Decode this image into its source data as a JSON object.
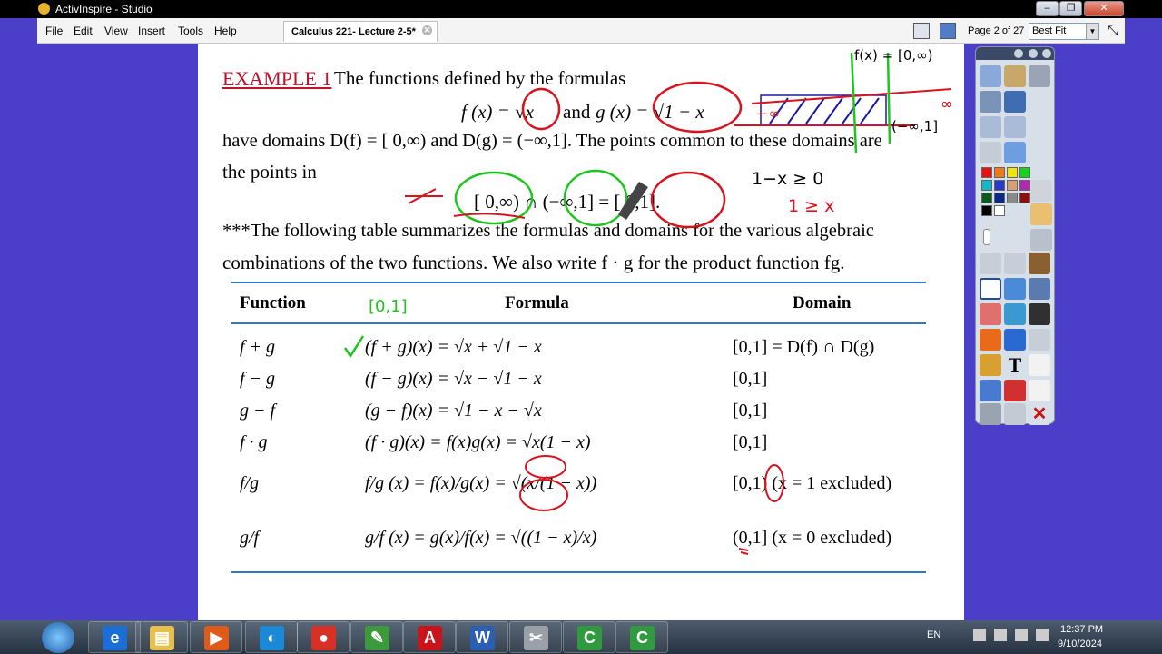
{
  "window": {
    "title": "ActivInspire - Studio",
    "buttons": [
      "–",
      "❐",
      "✕"
    ]
  },
  "menu": {
    "items": [
      "File",
      "Edit",
      "View",
      "Insert",
      "Tools",
      "Help"
    ],
    "doc_tab": "Calculus 221- Lecture 2-5*",
    "doc_tab_close": "✕",
    "page_indicator": "Page 2 of 27",
    "zoom": "Best Fit",
    "zoom_arrow": "▼",
    "expand_glyph": "⤡"
  },
  "slide": {
    "example_label": "EXAMPLE 1",
    "line1": "The functions defined by the formulas",
    "formula_f": "f (x) = √x",
    "formula_and": "and",
    "formula_g": "g (x) = √1 − x",
    "line3": "have domains D(f) = [ 0,∞) and D(g) = (−∞,1]. The points common to these domains are",
    "line4": "the points in",
    "intersection": "[ 0,∞) ∩ (−∞,1] = [ 0,1].",
    "line5": "***The following table summarizes the formulas and domains for the various algebraic",
    "line6": "combinations of the two functions. We also write f · g for the product function fg.",
    "table": {
      "headers": [
        "Function",
        "Formula",
        "Domain"
      ],
      "rows": [
        {
          "function": "f + g",
          "formula": "(f + g)(x) = √x + √1 − x",
          "domain": "[0,1] = D(f) ∩ D(g)"
        },
        {
          "function": "f − g",
          "formula": "(f − g)(x) = √x − √1 − x",
          "domain": "[0,1]"
        },
        {
          "function": "g − f",
          "formula": "(g − f)(x) = √1 − x − √x",
          "domain": "[0,1]"
        },
        {
          "function": "f · g",
          "formula": "(f · g)(x) = f(x)g(x) = √x(1 − x)",
          "domain": "[0,1]"
        },
        {
          "function": "f/g",
          "formula": "f/g (x) = f(x)/g(x) = √(x/(1 − x))",
          "domain": "[0,1) (x = 1 excluded)"
        },
        {
          "function": "g/f",
          "formula": "g/f (x) = g(x)/f(x) = √((1 − x)/x)",
          "domain": "(0,1] (x = 0 excluded)"
        }
      ]
    }
  },
  "annotations": {
    "header_note": "[0,1]",
    "top_right_note": "f(x) = [0,∞)",
    "interval_note": "(−∞,1]",
    "minus_inf": "−∞",
    "inf": "∞",
    "ineq1": "1−x ≥ 0",
    "ineq2": "1 ≥ x",
    "ink_colors": {
      "red": "#d8121e",
      "green": "#1ec51e",
      "blue": "#1a1aa0"
    }
  },
  "taskbar": {
    "lang": "EN",
    "time": "12:37 PM",
    "date": "9/10/2024",
    "apps": [
      {
        "name": "internet-explorer",
        "glyph": "e",
        "color": "#1a6fd6"
      },
      {
        "name": "file-explorer",
        "glyph": "▤",
        "color": "#e9c04a"
      },
      {
        "name": "media-player",
        "glyph": "▶",
        "color": "#e05a1a"
      },
      {
        "name": "edge",
        "glyph": "◐",
        "color": "#1a8ad6"
      },
      {
        "name": "chrome",
        "glyph": "●",
        "color": "#d93025"
      },
      {
        "name": "activinspire",
        "glyph": "✎",
        "color": "#3c9a3c"
      },
      {
        "name": "acrobat",
        "glyph": "A",
        "color": "#c8141a"
      },
      {
        "name": "word",
        "glyph": "W",
        "color": "#2b5fb3"
      },
      {
        "name": "tools",
        "glyph": "✂",
        "color": "#9aa0a8"
      },
      {
        "name": "camtasia-1",
        "glyph": "C",
        "color": "#2f9a3e"
      },
      {
        "name": "camtasia-2",
        "glyph": "C",
        "color": "#2f9a3e"
      }
    ]
  }
}
